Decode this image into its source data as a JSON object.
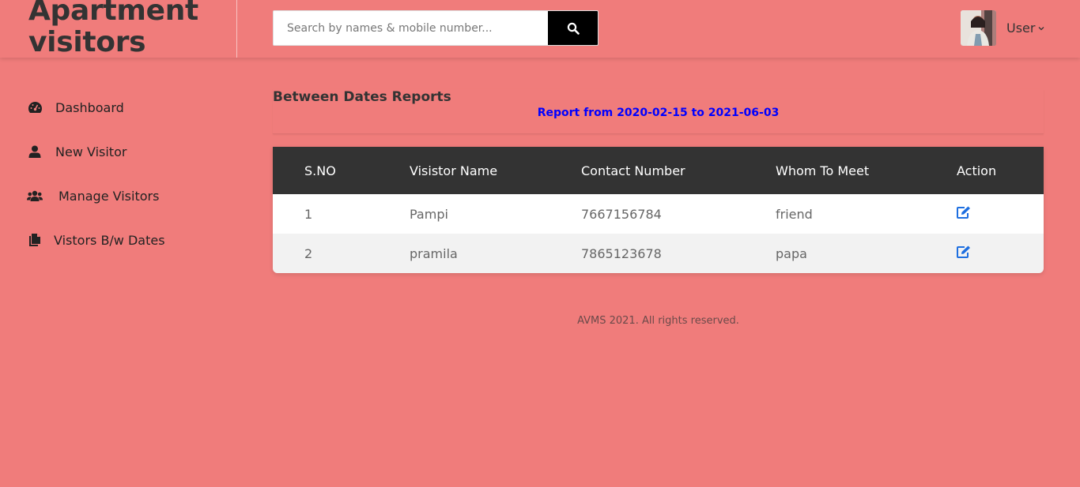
{
  "brand": {
    "title": "Apartment visitors"
  },
  "search": {
    "placeholder": "Search by names & mobile number...",
    "icon": "search-icon"
  },
  "user": {
    "name": "User",
    "caret_icon": "chevron-down-icon"
  },
  "sidebar": {
    "items": [
      {
        "label": "Dashboard",
        "icon": "dashboard-gauge-icon"
      },
      {
        "label": "New Visitor",
        "icon": "user-icon"
      },
      {
        "label": "Manage Visitors",
        "icon": "users-group-icon"
      },
      {
        "label": "Vistors B/w Dates",
        "icon": "documents-icon"
      }
    ]
  },
  "main": {
    "title": "Between Dates Reports",
    "report_text": "Report from 2020-02-15 to 2021-06-03",
    "table": {
      "headers": [
        "S.NO",
        "Visistor Name",
        "Contact Number",
        "Whom To Meet",
        "Action"
      ],
      "rows": [
        {
          "sno": "1",
          "name": "Pampi",
          "contact": "7667156784",
          "whom": "friend",
          "action_icon": "edit-icon"
        },
        {
          "sno": "2",
          "name": "pramila",
          "contact": "7865123678",
          "whom": "papa",
          "action_icon": "edit-icon"
        }
      ]
    }
  },
  "footer": {
    "text": "AVMS 2021. All rights reserved."
  },
  "colors": {
    "background": "#f07c7b",
    "table_header": "#333333",
    "report_text": "#0000ff",
    "edit_icon": "#1e6fe0"
  }
}
